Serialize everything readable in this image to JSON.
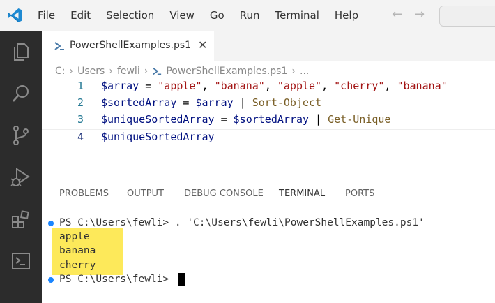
{
  "menu": [
    "File",
    "Edit",
    "Selection",
    "View",
    "Go",
    "Run",
    "Terminal",
    "Help"
  ],
  "colors": {
    "activity_bar": "#2c2c2c",
    "highlight": "#fde95a",
    "string": "#a31515",
    "variable": "#001080",
    "cmdlet": "#795e26",
    "line_number": "#237893"
  },
  "tab": {
    "label": "PowerShellExamples.ps1",
    "close": "✕"
  },
  "breadcrumb": [
    "C:",
    "Users",
    "fewli",
    "PowerShellExamples.ps1",
    "..."
  ],
  "editor": {
    "lines": [
      {
        "number": "1",
        "tokens": [
          {
            "t": "$array",
            "k": "var"
          },
          {
            "t": " = ",
            "k": "op"
          },
          {
            "t": "\"apple\"",
            "k": "str"
          },
          {
            "t": ", ",
            "k": "op"
          },
          {
            "t": "\"banana\"",
            "k": "str"
          },
          {
            "t": ", ",
            "k": "op"
          },
          {
            "t": "\"apple\"",
            "k": "str"
          },
          {
            "t": ", ",
            "k": "op"
          },
          {
            "t": "\"cherry\"",
            "k": "str"
          },
          {
            "t": ", ",
            "k": "op"
          },
          {
            "t": "\"banana\"",
            "k": "str"
          }
        ]
      },
      {
        "number": "2",
        "tokens": [
          {
            "t": "$sortedArray",
            "k": "var"
          },
          {
            "t": " = ",
            "k": "op"
          },
          {
            "t": "$array",
            "k": "var"
          },
          {
            "t": " | ",
            "k": "op"
          },
          {
            "t": "Sort-Object",
            "k": "cmd"
          }
        ]
      },
      {
        "number": "3",
        "tokens": [
          {
            "t": "$uniqueSortedArray",
            "k": "var"
          },
          {
            "t": " = ",
            "k": "op"
          },
          {
            "t": "$sortedArray",
            "k": "var"
          },
          {
            "t": " | ",
            "k": "op"
          },
          {
            "t": "Get-Unique",
            "k": "cmd"
          }
        ]
      },
      {
        "number": "4",
        "tokens": [
          {
            "t": "$uniqueSortedArray",
            "k": "var"
          }
        ]
      }
    ]
  },
  "panel": {
    "tabs": [
      "PROBLEMS",
      "OUTPUT",
      "DEBUG CONSOLE",
      "TERMINAL",
      "PORTS"
    ],
    "active": "TERMINAL"
  },
  "terminal": {
    "prompt1": "PS C:\\Users\\fewli> . 'C:\\Users\\fewli\\PowerShellExamples.ps1'",
    "output": [
      "apple",
      "banana",
      "cherry"
    ],
    "prompt2": "PS C:\\Users\\fewli> "
  }
}
